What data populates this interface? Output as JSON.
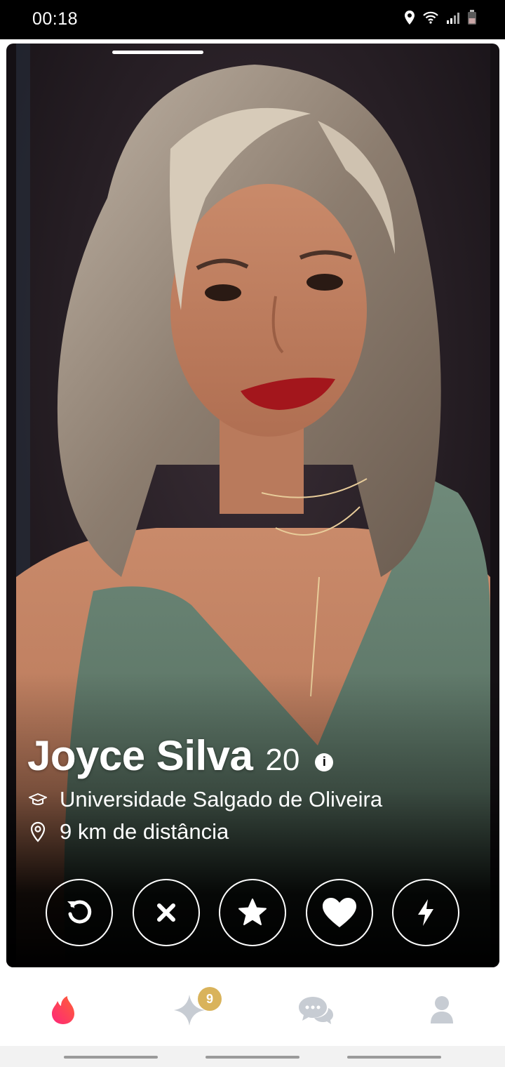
{
  "status_bar": {
    "time": "00:18",
    "icons": [
      "location-icon",
      "wifi-icon",
      "signal-icon",
      "battery-icon"
    ]
  },
  "profile": {
    "name": "Joyce Silva",
    "age": "20",
    "school": "Universidade Salgado de Oliveira",
    "distance": "9 km de distância",
    "info_icon_label": "i"
  },
  "actions": [
    {
      "name": "rewind-icon"
    },
    {
      "name": "nope-icon"
    },
    {
      "name": "super-like-icon"
    },
    {
      "name": "like-icon"
    },
    {
      "name": "boost-icon"
    }
  ],
  "bottom_nav": {
    "items": [
      "flame-icon",
      "sparkle-icon",
      "chat-icon",
      "profile-icon"
    ],
    "likes_badge": "9"
  },
  "colors": {
    "brand": "#fe3c72",
    "badge": "#d9b35b",
    "nav_inactive": "#c7ccd3"
  }
}
